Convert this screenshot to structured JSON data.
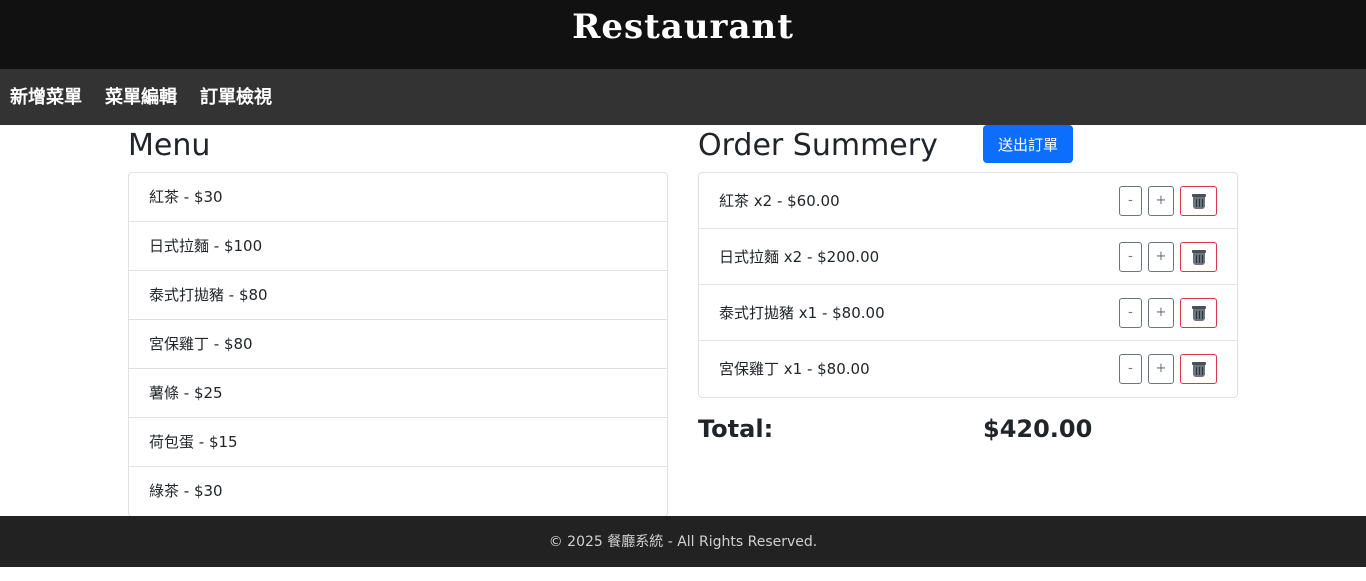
{
  "header": {
    "title": "Restaurant"
  },
  "nav": {
    "items": [
      {
        "label": "新增菜單"
      },
      {
        "label": "菜單編輯"
      },
      {
        "label": "訂單檢視"
      }
    ]
  },
  "menu": {
    "title": "Menu",
    "items": [
      "紅茶 - $30",
      "日式拉麵 - $100",
      "泰式打拋豬 - $80",
      "宮保雞丁 - $80",
      "薯條 - $25",
      "荷包蛋 - $15",
      "綠茶 - $30"
    ]
  },
  "order": {
    "title": "Order Summery",
    "submit_label": "送出訂單",
    "items": [
      {
        "text": "紅茶 x2 - $60.00",
        "minus": "-",
        "plus": "+",
        "delete_icon": "trash-icon"
      },
      {
        "text": "日式拉麵 x2 - $200.00",
        "minus": "-",
        "plus": "+",
        "delete_icon": "trash-icon"
      },
      {
        "text": "泰式打拋豬 x1 - $80.00",
        "minus": "-",
        "plus": "+",
        "delete_icon": "trash-icon"
      },
      {
        "text": "宮保雞丁 x1 - $80.00",
        "minus": "-",
        "plus": "+",
        "delete_icon": "trash-icon"
      }
    ],
    "total_label": "Total:",
    "total_value": "$420.00"
  },
  "footer": {
    "text": "© 2025 餐廳系統 - All Rights Reserved."
  },
  "colors": {
    "header_bg": "#111111",
    "nav_bg": "#333333",
    "footer_bg": "#222222",
    "primary": "#0d6efd",
    "danger": "#dc3545",
    "secondary": "#6c757d"
  }
}
